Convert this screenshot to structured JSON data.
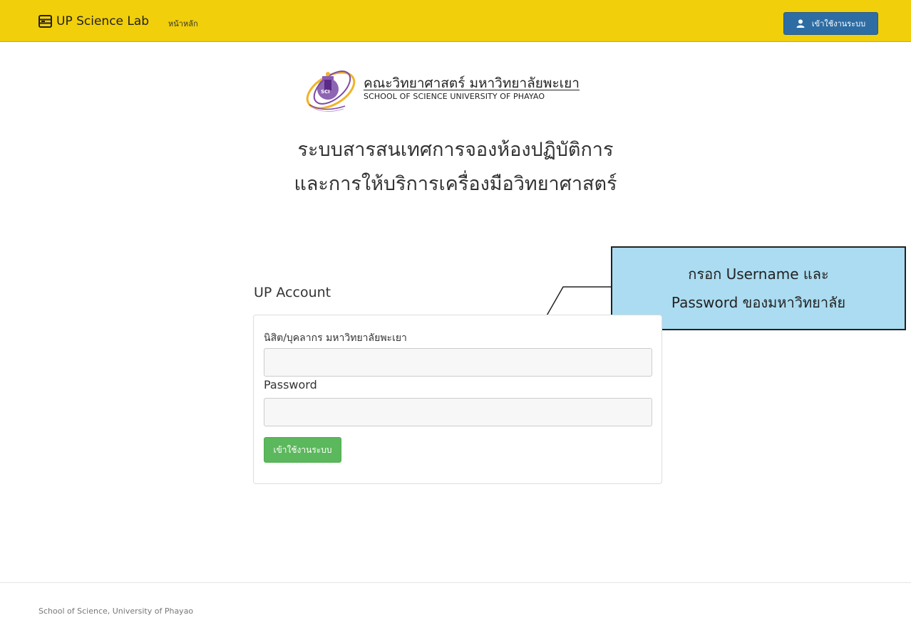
{
  "navbar": {
    "brand": "UP Science Lab",
    "home_link": "หน้าหลัก",
    "login_button": "เข้าใช้งานระบบ",
    "brand_icon": "server-icon",
    "login_icon": "user-icon",
    "background_color": "#f1cf0a",
    "login_color": "#2e6da4"
  },
  "header": {
    "faculty_th": "คณะวิทยาศาสตร์ มหาวิทยาลัยพะเยา",
    "faculty_en": "SCHOOL OF SCIENCE UNIVERSITY OF PHAYAO",
    "title_line1": "ระบบสารสนเทศการจองห้องปฏิบัติการ",
    "title_line2": "และการให้บริการเครื่องมือวิทยาศาสตร์"
  },
  "callout": {
    "line1": "กรอก Username และ",
    "line2": "Password ของมหาวิทยาลัย",
    "background_color": "#abdcf1"
  },
  "login": {
    "heading": "UP Account",
    "username_label": "นิสิต/บุคลากร มหาวิทยาลัยพะเยา",
    "username_value": "",
    "password_label": "Password",
    "password_value": "",
    "submit_label": "เข้าใช้งานระบบ",
    "submit_color": "#5cb85c"
  },
  "footer": {
    "text": "School of Science, University of Phayao"
  }
}
